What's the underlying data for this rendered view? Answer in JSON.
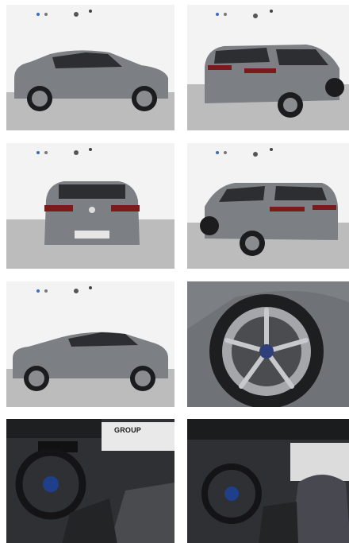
{
  "gallery": {
    "images": [
      {
        "view": "side-left"
      },
      {
        "view": "rear-three-quarter-right"
      },
      {
        "view": "rear"
      },
      {
        "view": "rear-three-quarter-left"
      },
      {
        "view": "side-left-2"
      },
      {
        "view": "wheel-detail"
      },
      {
        "view": "interior-dashboard",
        "dealer_text": "GROUP"
      },
      {
        "view": "interior-driver-seat"
      }
    ]
  },
  "colors": {
    "body": "#7c7f83",
    "body_dark": "#5e6165",
    "floor": "#bdbdbd",
    "wall": "#f4f4f4",
    "interior": "#3a3b3d"
  }
}
